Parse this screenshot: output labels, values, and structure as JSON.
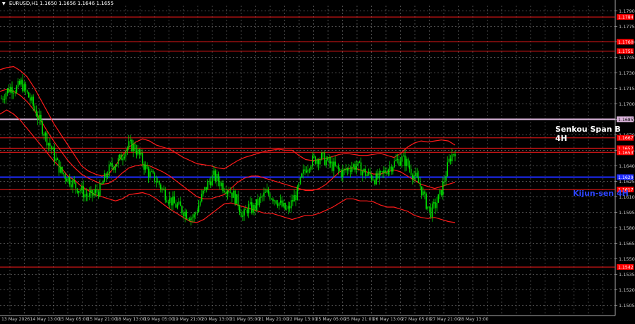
{
  "header": {
    "icon": "triangle-down-icon",
    "symbol": "EURUSD,H1",
    "ohlc": "1.1650 1.1656 1.1646 1.1655"
  },
  "annotations": {
    "senkou": "Senkou Span B 4H",
    "kijun": "Kijun-sen 4H"
  },
  "colors": {
    "background": "#000000",
    "grid": "#7a7a7a",
    "candle": "#00e000",
    "bands": "#ff1a1a",
    "level_lines": "#ff1a1a",
    "senkou_line": "#d9b3d9",
    "kijun_line": "#1e2bff",
    "axis_text": "#c8c8c8",
    "tag_red": "#ff0000",
    "tag_blue": "#1e2bff",
    "tag_pink": "#d9b3d9"
  },
  "chart_data": {
    "type": "candlestick",
    "symbol": "EURUSD",
    "timeframe": "H1",
    "ylim": [
      1.1495,
      1.1795
    ],
    "y_ticks": [
      "1.1790",
      "1.1775",
      "1.1760",
      "1.1745",
      "1.1730",
      "1.1715",
      "1.1700",
      "1.1685",
      "1.1670",
      "1.1655",
      "1.1640",
      "1.1625",
      "1.1610",
      "1.1595",
      "1.1580",
      "1.1565",
      "1.1550",
      "1.1535",
      "1.1520",
      "1.1505"
    ],
    "x_labels": [
      "13 May 2026",
      "14 May 13:00",
      "15 May 05:00",
      "15 May 21:00",
      "18 May 13:00",
      "19 May 05:00",
      "19 May 21:00",
      "20 May 13:00",
      "21 May 05:00",
      "21 May 21:00",
      "22 May 13:00",
      "25 May 05:00",
      "25 May 21:00",
      "26 May 13:00",
      "27 May 05:00",
      "27 May 21:00",
      "28 May 13:00"
    ],
    "horizontal_levels": [
      {
        "value": 1.1784,
        "tag": "1.1784",
        "style": "level"
      },
      {
        "value": 1.176,
        "tag": "1.1760",
        "style": "level"
      },
      {
        "value": 1.1751,
        "tag": "1.1751",
        "style": "level"
      },
      {
        "value": 1.1685,
        "tag": "1.1685",
        "style": "senkou"
      },
      {
        "value": 1.1667,
        "tag": "1.1667",
        "style": "level"
      },
      {
        "value": 1.1657,
        "tag": "1.1657",
        "style": "level"
      },
      {
        "value": 1.1653,
        "tag": "1.1653",
        "style": "level"
      },
      {
        "value": 1.1629,
        "tag": "1.1629",
        "style": "kijun"
      },
      {
        "value": 1.1617,
        "tag": "1.1617",
        "style": "level"
      },
      {
        "value": 1.1542,
        "tag": "1.1542",
        "style": "level"
      }
    ],
    "close_series": [
      1.1705,
      1.1712,
      1.1716,
      1.1714,
      1.172,
      1.1711,
      1.1703,
      1.1692,
      1.168,
      1.1668,
      1.1658,
      1.1646,
      1.1635,
      1.163,
      1.1626,
      1.162,
      1.1617,
      1.1612,
      1.161,
      1.1614,
      1.1617,
      1.1628,
      1.1638,
      1.1642,
      1.1646,
      1.1655,
      1.166,
      1.1658,
      1.165,
      1.164,
      1.1632,
      1.1628,
      1.1622,
      1.1614,
      1.1608,
      1.1603,
      1.16,
      1.1596,
      1.1592,
      1.159,
      1.1602,
      1.1614,
      1.1624,
      1.163,
      1.1626,
      1.162,
      1.1618,
      1.1612,
      1.1604,
      1.159,
      1.16,
      1.1598,
      1.1604,
      1.161,
      1.1614,
      1.161,
      1.1606,
      1.16,
      1.1596,
      1.1606,
      1.1614,
      1.163,
      1.164,
      1.1645,
      1.1647,
      1.1648,
      1.1644,
      1.164,
      1.1637,
      1.1633,
      1.1636,
      1.164,
      1.164,
      1.1636,
      1.1632,
      1.163,
      1.1627,
      1.163,
      1.1636,
      1.164,
      1.1644,
      1.1647,
      1.1644,
      1.1636,
      1.1628,
      1.162,
      1.1605,
      1.1595,
      1.1602,
      1.1612,
      1.163,
      1.1648,
      1.1655
    ],
    "bollinger_upper": [
      1.1733,
      1.1735,
      1.1736,
      1.1732,
      1.1726,
      1.1716,
      1.1704,
      1.1692,
      1.168,
      1.167,
      1.166,
      1.165,
      1.164,
      1.1635,
      1.1632,
      1.163,
      1.1632,
      1.164,
      1.165,
      1.1658,
      1.1663,
      1.1666,
      1.1664,
      1.166,
      1.1658,
      1.1656,
      1.1652,
      1.1648,
      1.1645,
      1.1642,
      1.1641,
      1.164,
      1.1638,
      1.1637,
      1.1641,
      1.1645,
      1.1648,
      1.165,
      1.1652,
      1.1654,
      1.1655,
      1.1656,
      1.1655,
      1.1655,
      1.165,
      1.1646,
      1.1645,
      1.1646,
      1.1647,
      1.1649,
      1.1651,
      1.1652,
      1.1651,
      1.165,
      1.165,
      1.1651,
      1.1652,
      1.165,
      1.1648,
      1.1652,
      1.1658,
      1.1662,
      1.1664,
      1.1663,
      1.1664,
      1.1665,
      1.1664,
      1.166
    ],
    "bollinger_middle": [
      1.1712,
      1.1714,
      1.1712,
      1.1708,
      1.1702,
      1.1694,
      1.1684,
      1.1673,
      1.1663,
      1.1654,
      1.1645,
      1.1638,
      1.1632,
      1.1628,
      1.1625,
      1.1622,
      1.1623,
      1.1627,
      1.1633,
      1.1638,
      1.164,
      1.1641,
      1.164,
      1.1637,
      1.1634,
      1.163,
      1.1625,
      1.162,
      1.1615,
      1.161,
      1.1608,
      1.1608,
      1.161,
      1.1612,
      1.1618,
      1.1624,
      1.1628,
      1.163,
      1.163,
      1.1628,
      1.1626,
      1.1624,
      1.1622,
      1.162,
      1.1618,
      1.1616,
      1.1616,
      1.1618,
      1.1622,
      1.1628,
      1.1634,
      1.1637,
      1.1638,
      1.1636,
      1.1634,
      1.1632,
      1.1632,
      1.1634,
      1.1636,
      1.1634,
      1.163,
      1.1626,
      1.1622,
      1.162,
      1.1618,
      1.162,
      1.1622,
      1.1624
    ],
    "bollinger_lower": [
      1.169,
      1.1694,
      1.169,
      1.1684,
      1.1676,
      1.1668,
      1.166,
      1.1652,
      1.1644,
      1.1638,
      1.163,
      1.1626,
      1.162,
      1.1616,
      1.1612,
      1.161,
      1.1608,
      1.1606,
      1.1608,
      1.1612,
      1.1613,
      1.1614,
      1.1612,
      1.1608,
      1.1603,
      1.1598,
      1.1594,
      1.159,
      1.1586,
      1.1585,
      1.1588,
      1.1593,
      1.1598,
      1.1603,
      1.1604,
      1.1602,
      1.16,
      1.1598,
      1.1596,
      1.1594,
      1.1594,
      1.1592,
      1.159,
      1.1588,
      1.159,
      1.1592,
      1.1592,
      1.1594,
      1.1597,
      1.16,
      1.1604,
      1.1608,
      1.1608,
      1.1606,
      1.1606,
      1.1605,
      1.1602,
      1.16,
      1.16,
      1.1598,
      1.1596,
      1.1592,
      1.159,
      1.1589,
      1.159,
      1.1588,
      1.1586,
      1.1585
    ]
  }
}
